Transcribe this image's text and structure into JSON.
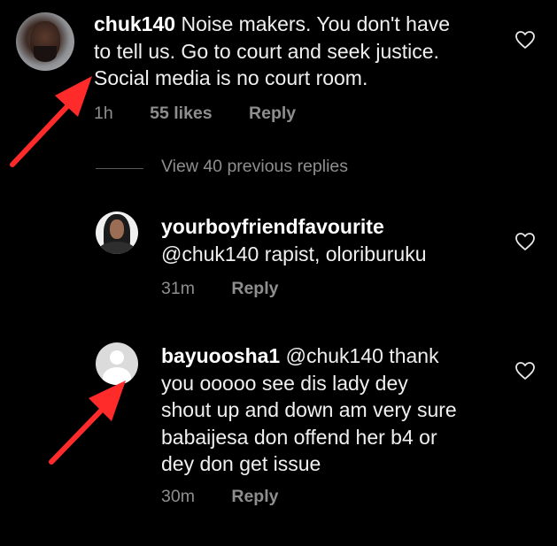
{
  "comments": [
    {
      "username": "chuk140",
      "text": "Noise makers. You don't have to tell us. Go to court and seek justice. Social media is no court room.",
      "line1_rest": " Noise makers. You don't have",
      "line2": "to tell us. Go to court and seek justice.",
      "line3": "Social media is no court room.",
      "time": "1h",
      "likes": "55 likes",
      "reply": "Reply"
    },
    {
      "username": "yourboyfriendfavourite",
      "mention": "@chuk140",
      "text": "rapist, oloriburuku",
      "time": "31m",
      "reply": "Reply"
    },
    {
      "username": "bayuoosha1",
      "mention": "@chuk140",
      "line1_rest": " @chuk140 thank",
      "line2": "you ooooo see dis lady dey",
      "line3": "shout up and down am very sure",
      "line4": "babaijesa don offend her b4 or",
      "line5": "dey don get issue",
      "time": "30m",
      "reply": "Reply"
    }
  ],
  "view_replies": "View 40 previous replies",
  "icons": {
    "like": "heart-outline-icon",
    "arrow": "red-arrow-annotation",
    "arrow_color": "#ff2a2a"
  }
}
